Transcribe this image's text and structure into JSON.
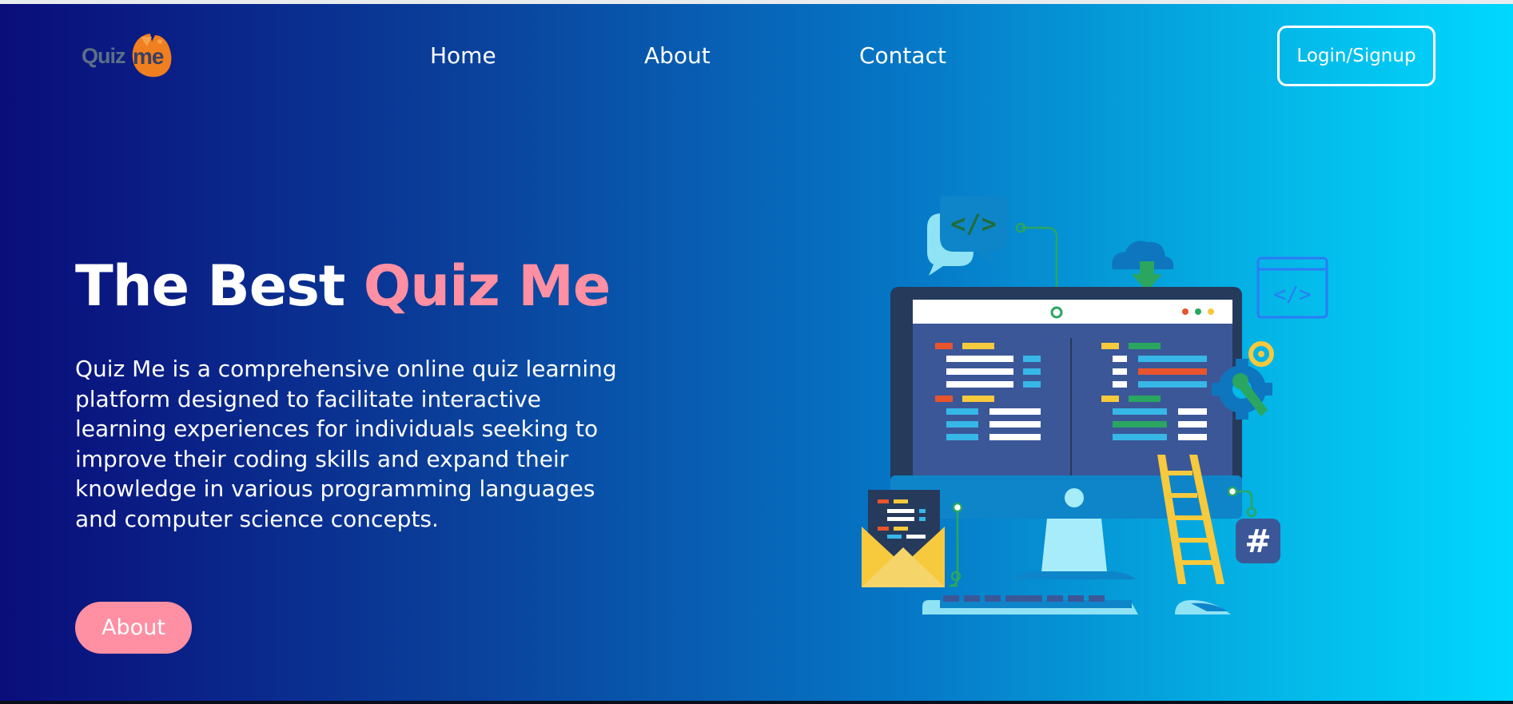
{
  "header": {
    "logo": {
      "part1": "Quiz",
      "part2": "me"
    },
    "nav": [
      {
        "label": "Home"
      },
      {
        "label": "About"
      },
      {
        "label": "Contact"
      }
    ],
    "login_label": "Login/Signup"
  },
  "hero": {
    "title_main": "The Best",
    "title_accent": "Quiz Me",
    "description": "Quiz Me is a comprehensive online quiz learning platform designed to facilitate interactive learning experiences for individuals seeking to improve their coding skills and expand their knowledge in various programming languages and computer science concepts.",
    "button_label": "About"
  },
  "illustration": {
    "code_tag_1": "</>",
    "code_tag_2": "</>",
    "hash_symbol": "#"
  },
  "colors": {
    "accent_pink": "#ff8fa3",
    "gradient_start": "#0a0d7a",
    "gradient_end": "#00d8ff",
    "logo_orange": "#f07f1f"
  }
}
